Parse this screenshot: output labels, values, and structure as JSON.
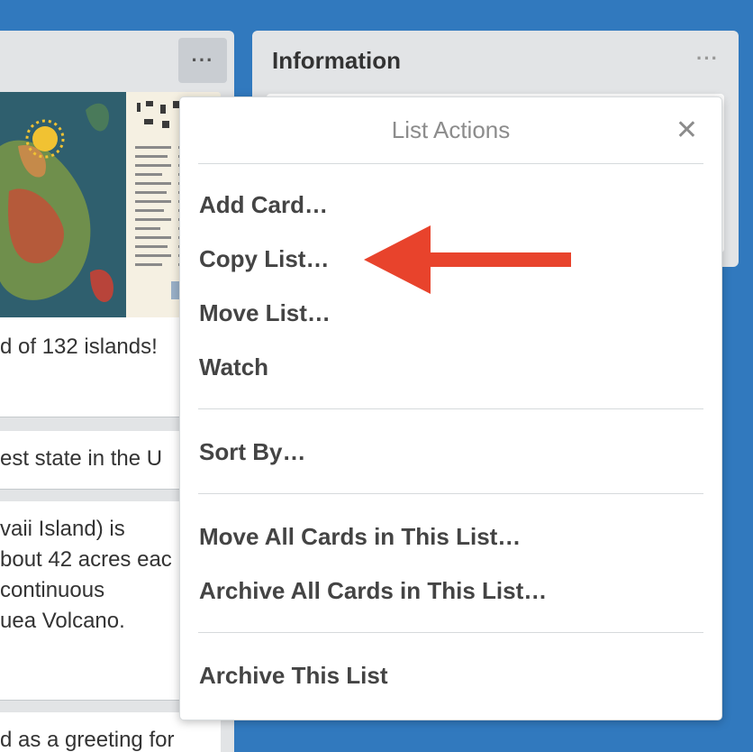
{
  "left_list": {
    "menu_icon": "ellipsis-icon",
    "cards": [
      "d of 132 islands!",
      "est state in the U",
      "vaii Island) is",
      "bout 42 acres eac",
      " continuous",
      "uea Volcano.",
      "d as a greeting for"
    ]
  },
  "right_list": {
    "title": "Information",
    "menu_icon": "ellipsis-icon"
  },
  "popover": {
    "title": "List Actions",
    "close_icon": "close-icon",
    "items": [
      "Add Card…",
      "Copy List…",
      "Move List…",
      "Watch",
      "Sort By…",
      "Move All Cards in This List…",
      "Archive All Cards in This List…",
      "Archive This List"
    ]
  },
  "annotation": {
    "arrow_color": "#e8432c",
    "target": "Copy List…"
  },
  "colors": {
    "board_background": "#3179be",
    "list_background": "#e2e4e6"
  }
}
